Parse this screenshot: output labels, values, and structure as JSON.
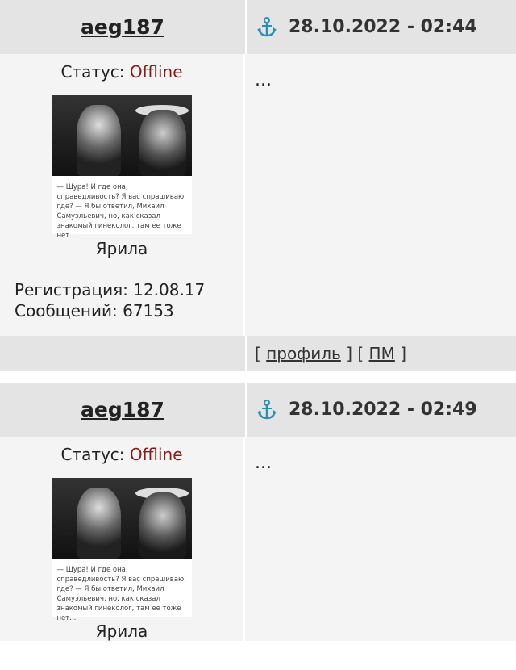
{
  "posts": [
    {
      "author": "aeg187",
      "date": "28.10.2022 - 02:44",
      "status_label": "Статус:",
      "status_value": "Offline",
      "avatar_caption": "— Шура! И где она, справедливость? Я вас спрашиваю, где? — Я бы ответил, Михаил Самуэльевич, но, как сказал знакомый гинеколог, там ее тоже нет...",
      "nick": "Ярила",
      "reg_label": "Регистрация:",
      "reg_value": "12.08.17",
      "msgs_label": "Сообщений:",
      "msgs_value": "67153",
      "body": "...",
      "links": {
        "open": "[",
        "profile": "профиль",
        "mid": "] [",
        "pm": "ПМ",
        "close": "]"
      }
    },
    {
      "author": "aeg187",
      "date": "28.10.2022 - 02:49",
      "status_label": "Статус:",
      "status_value": "Offline",
      "avatar_caption": "— Шура! И где она, справедливость? Я вас спрашиваю, где? — Я бы ответил, Михаил Самуэльевич, но, как сказал знакомый гинеколог, там ее тоже нет...",
      "nick": "Ярила",
      "body": "..."
    }
  ],
  "colors": {
    "header_bg": "#e4e4e4",
    "body_bg": "#f4f4f4",
    "offline": "#8b1a1a",
    "anchor": "#2a8fb4"
  },
  "icons": {
    "post_anchor": "anchor-icon"
  }
}
